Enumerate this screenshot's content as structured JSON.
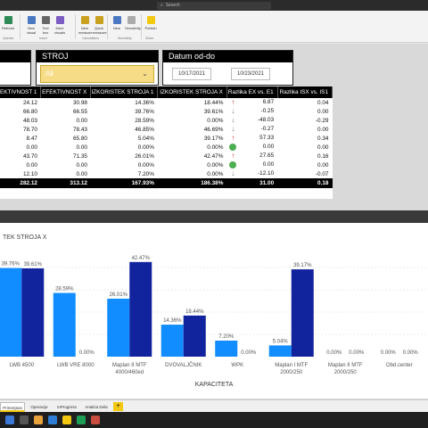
{
  "app": {
    "search_placeholder": "Search"
  },
  "ribbon": {
    "buttons": [
      "New visual",
      "Text box",
      "More visuals",
      "New measure",
      "Quick measure",
      "New",
      "Sensitivity",
      "Publish"
    ],
    "refresh_label": "Refresh",
    "groups": [
      "Queries",
      "Insert",
      "Calculations",
      "Sensitivity",
      "Share"
    ]
  },
  "slicers": {
    "stroj": {
      "title": "STROJ",
      "value": "All"
    },
    "datum": {
      "title": "Datum od-do",
      "from": "10/17/2021",
      "to": "10/23/2021"
    }
  },
  "table": {
    "columns": [
      "EKTIVNOST 1",
      "EFEKTIVNOST X",
      "IZKORISTEK STROJA 1",
      "IZKORISTEK STROJA X",
      "Razlika EX vs. E1",
      "Razlika ISX vs. IS1"
    ],
    "rows": [
      {
        "c": [
          "24.12",
          "30.98",
          "14.36%",
          "18.44%",
          "6.87",
          "0.04"
        ],
        "ind": "up-red"
      },
      {
        "c": [
          "66.80",
          "66.55",
          "39.76%",
          "39.61%",
          "-0.25",
          "0.00"
        ],
        "ind": "down-grey"
      },
      {
        "c": [
          "48.03",
          "0.00",
          "28.59%",
          "0.00%",
          "-48.03",
          "-0.29"
        ],
        "ind": "down-grey"
      },
      {
        "c": [
          "78.70",
          "78.43",
          "46.85%",
          "46.69%",
          "-0.27",
          "0.00"
        ],
        "ind": "down-grey"
      },
      {
        "c": [
          "8.47",
          "65.80",
          "5.04%",
          "39.17%",
          "57.33",
          "0.34"
        ],
        "ind": "up-red"
      },
      {
        "c": [
          "0.00",
          "0.00",
          "0.00%",
          "0.00%",
          "0.00",
          "0.00"
        ],
        "ind": "circle-green"
      },
      {
        "c": [
          "43.70",
          "71.35",
          "26.01%",
          "42.47%",
          "27.65",
          "0.16"
        ],
        "ind": "up-red"
      },
      {
        "c": [
          "0.00",
          "0.00",
          "0.00%",
          "0.00%",
          "0.00",
          "0.00"
        ],
        "ind": "circle-green"
      },
      {
        "c": [
          "12.10",
          "0.00",
          "7.20%",
          "0.00%",
          "-12.10",
          "-0.07"
        ],
        "ind": "down-grey"
      }
    ],
    "total": [
      "282.12",
      "313.12",
      "167.93%",
      "186.38%",
      "31.00",
      "0.18"
    ]
  },
  "chart_data": {
    "type": "bar",
    "title": "TEK STROJA X",
    "xlabel": "KAPACITETA",
    "ylabel": "",
    "categories": [
      "LWB 4500",
      "LWB VRE 8000",
      "Maplan II MTF 4000/460ed",
      "DVOVALJČNIK",
      "WPK",
      "Maplan I MTF 2000/250",
      "Maplan II MTF 2000/250",
      "Obd.center"
    ],
    "series": [
      {
        "values": [
          39.76,
          28.59,
          26.01,
          14.36,
          7.2,
          5.04,
          0.0,
          0.0
        ],
        "labels": [
          "39.76%",
          "28.59%",
          "26.01%",
          "14.36%",
          "7.20%",
          "5.04%",
          "0.00%",
          "0.00%"
        ],
        "color": "#118dff"
      },
      {
        "values": [
          39.61,
          0.0,
          42.47,
          18.44,
          0.0,
          39.17,
          0.0,
          0.0
        ],
        "labels": [
          "39.61%",
          "0.00%",
          "42.47%",
          "18.44%",
          "0.00%",
          "39.17%",
          "0.00%",
          "0.00%"
        ],
        "color": "#12239e"
      }
    ],
    "ylim": [
      0,
      50
    ],
    "grid": true
  },
  "tabs": [
    "Primerjava",
    "Operacije",
    "InProgress",
    "Analiza Dela"
  ],
  "tab_add": "+",
  "colors": {
    "accent": "#f2c811",
    "series1": "#118dff",
    "series2": "#12239e",
    "up": "#d13438",
    "circle": "#4caf50",
    "down": "#7a7a7a"
  }
}
